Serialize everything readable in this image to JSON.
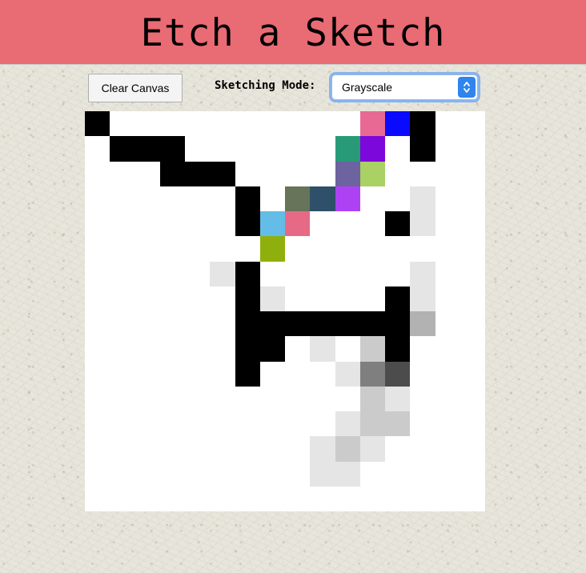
{
  "header": {
    "title": "Etch a Sketch",
    "background_color": "#e96b74"
  },
  "controls": {
    "clear_button_label": "Clear Canvas",
    "mode_label": "Sketching Mode:",
    "mode_selected": "Grayscale",
    "mode_options_visible": [
      "Grayscale"
    ]
  },
  "canvas": {
    "background_color": "#ffffff",
    "grid_columns": 16,
    "grid_rows": 16,
    "filled_cells": [
      {
        "col": 0,
        "row": 0,
        "color": "#000000"
      },
      {
        "col": 11,
        "row": 0,
        "color": "#e86a94"
      },
      {
        "col": 12,
        "row": 0,
        "color": "#0a0aff"
      },
      {
        "col": 13,
        "row": 0,
        "color": "#000000"
      },
      {
        "col": 1,
        "row": 1,
        "color": "#000000"
      },
      {
        "col": 2,
        "row": 1,
        "color": "#000000"
      },
      {
        "col": 3,
        "row": 1,
        "color": "#000000"
      },
      {
        "col": 10,
        "row": 1,
        "color": "#289a78"
      },
      {
        "col": 11,
        "row": 1,
        "color": "#7d08dc"
      },
      {
        "col": 13,
        "row": 1,
        "color": "#000000"
      },
      {
        "col": 3,
        "row": 2,
        "color": "#000000"
      },
      {
        "col": 4,
        "row": 2,
        "color": "#000000"
      },
      {
        "col": 5,
        "row": 2,
        "color": "#000000"
      },
      {
        "col": 10,
        "row": 2,
        "color": "#6c63a0"
      },
      {
        "col": 11,
        "row": 2,
        "color": "#a9d163"
      },
      {
        "col": 6,
        "row": 3,
        "color": "#000000"
      },
      {
        "col": 8,
        "row": 3,
        "color": "#687459"
      },
      {
        "col": 9,
        "row": 3,
        "color": "#2e5069"
      },
      {
        "col": 10,
        "row": 3,
        "color": "#ad42f4"
      },
      {
        "col": 13,
        "row": 3,
        "color": "#e5e5e5"
      },
      {
        "col": 6,
        "row": 4,
        "color": "#000000"
      },
      {
        "col": 7,
        "row": 4,
        "color": "#63bde6"
      },
      {
        "col": 8,
        "row": 4,
        "color": "#e66a86"
      },
      {
        "col": 12,
        "row": 4,
        "color": "#000000"
      },
      {
        "col": 13,
        "row": 4,
        "color": "#e5e5e5"
      },
      {
        "col": 7,
        "row": 5,
        "color": "#8fb00c"
      },
      {
        "col": 5,
        "row": 6,
        "color": "#e5e5e5"
      },
      {
        "col": 6,
        "row": 6,
        "color": "#000000"
      },
      {
        "col": 13,
        "row": 6,
        "color": "#e5e5e5"
      },
      {
        "col": 6,
        "row": 7,
        "color": "#000000"
      },
      {
        "col": 7,
        "row": 7,
        "color": "#e5e5e5"
      },
      {
        "col": 12,
        "row": 7,
        "color": "#000000"
      },
      {
        "col": 13,
        "row": 7,
        "color": "#e5e5e5"
      },
      {
        "col": 6,
        "row": 8,
        "color": "#000000"
      },
      {
        "col": 7,
        "row": 8,
        "color": "#000000"
      },
      {
        "col": 8,
        "row": 8,
        "color": "#000000"
      },
      {
        "col": 9,
        "row": 8,
        "color": "#000000"
      },
      {
        "col": 10,
        "row": 8,
        "color": "#000000"
      },
      {
        "col": 11,
        "row": 8,
        "color": "#000000"
      },
      {
        "col": 12,
        "row": 8,
        "color": "#000000"
      },
      {
        "col": 13,
        "row": 8,
        "color": "#b2b2b2"
      },
      {
        "col": 6,
        "row": 9,
        "color": "#000000"
      },
      {
        "col": 7,
        "row": 9,
        "color": "#000000"
      },
      {
        "col": 9,
        "row": 9,
        "color": "#e5e5e5"
      },
      {
        "col": 11,
        "row": 9,
        "color": "#cbcbcb"
      },
      {
        "col": 12,
        "row": 9,
        "color": "#000000"
      },
      {
        "col": 6,
        "row": 10,
        "color": "#000000"
      },
      {
        "col": 10,
        "row": 10,
        "color": "#e5e5e5"
      },
      {
        "col": 11,
        "row": 10,
        "color": "#7f7f7f"
      },
      {
        "col": 12,
        "row": 10,
        "color": "#4c4c4c"
      },
      {
        "col": 11,
        "row": 11,
        "color": "#cbcbcb"
      },
      {
        "col": 12,
        "row": 11,
        "color": "#e5e5e5"
      },
      {
        "col": 10,
        "row": 12,
        "color": "#e5e5e5"
      },
      {
        "col": 11,
        "row": 12,
        "color": "#cbcbcb"
      },
      {
        "col": 12,
        "row": 12,
        "color": "#cbcbcb"
      },
      {
        "col": 9,
        "row": 13,
        "color": "#e5e5e5"
      },
      {
        "col": 10,
        "row": 13,
        "color": "#cbcbcb"
      },
      {
        "col": 11,
        "row": 13,
        "color": "#e5e5e5"
      },
      {
        "col": 9,
        "row": 14,
        "color": "#e5e5e5"
      },
      {
        "col": 10,
        "row": 14,
        "color": "#e5e5e5"
      }
    ]
  }
}
